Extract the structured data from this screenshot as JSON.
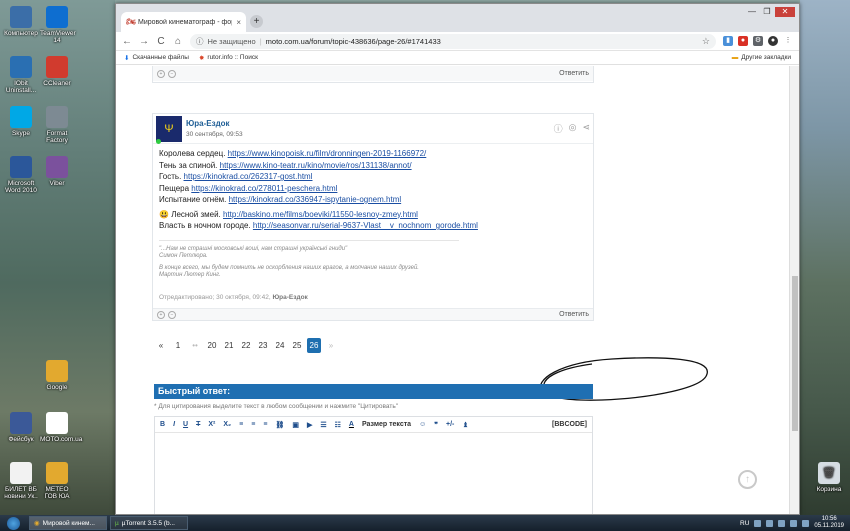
{
  "desktop": {
    "icons_left": [
      {
        "label": "Компьютер",
        "icon": "computer-icon",
        "color": "#3b6ea8"
      },
      {
        "label": "TeamViewer 14",
        "icon": "teamviewer-icon",
        "color": "#0e6ed0"
      },
      {
        "label": "IObit Uninstall...",
        "icon": "iobit-icon",
        "color": "#2a6fb2"
      },
      {
        "label": "CCleaner",
        "icon": "ccleaner-icon",
        "color": "#d13b2e"
      },
      {
        "label": "Skype",
        "icon": "skype-icon",
        "color": "#00a8e6"
      },
      {
        "label": "Format Factory",
        "icon": "formatfactory-icon",
        "color": "#7d8a93"
      },
      {
        "label": "Microsoft Word 2010",
        "icon": "word-icon",
        "color": "#2b579a"
      },
      {
        "label": "Viber",
        "icon": "viber-icon",
        "color": "#7b519d"
      },
      {
        "label": "Google",
        "icon": "chrome-icon",
        "color": "#e2a92f"
      },
      {
        "label": "Фейсбук",
        "icon": "facebook-icon",
        "color": "#3b5998"
      },
      {
        "label": "МОТО.com.ua",
        "icon": "moto-icon",
        "color": "#ffffff"
      },
      {
        "label": "БИЛЕТ ВБ новини Ук..",
        "icon": "file-icon",
        "color": "#f2f2f2"
      },
      {
        "label": "МЕТЕО ГОВ ЮА",
        "icon": "chrome-icon",
        "color": "#e2a92f"
      }
    ],
    "recycle_bin": "Корзина"
  },
  "browser": {
    "tab_title": "Мировой кинематограф - фор...",
    "tab_close": "×",
    "new_tab": "+",
    "back": "←",
    "forward": "→",
    "reload": "C",
    "home": "⌂",
    "security": "Не защищено",
    "url": "moto.com.ua/forum/topic-438636/page-26/#1741433",
    "bookmarks": [
      "Скачанные файлы",
      "rutor.info :: Поиск"
    ],
    "other_bookmarks": "Другие закладки",
    "controls": {
      "min": "—",
      "max": "❐",
      "close": "✕"
    }
  },
  "page": {
    "reply_label": "Ответить",
    "post": {
      "author": "Юра-Ездок",
      "date": "30 сентября, 09:53",
      "lines": [
        {
          "text": "Королева сердец. ",
          "link": "https://www.kinopoisk.ru/film/dronningen-2019-1166972/"
        },
        {
          "text": "Тень за спиной. ",
          "link": "https://www.kino-teatr.ru/kino/movie/ros/131138/annot/"
        },
        {
          "text": "Гость. ",
          "link": "https://kinokrad.co/262317-gost.html"
        },
        {
          "text": "Пещера ",
          "link": "https://kinokrad.co/278011-peschera.html"
        },
        {
          "text": "Испытание огнём. ",
          "link": "https://kinokrad.co/336947-ispytanie-ognem.html"
        },
        {
          "text": "Лесной змей. ",
          "link": "http://baskino.me/films/boeviki/11550-lesnoy-zmey.html"
        },
        {
          "text": "Власть в ночном городе. ",
          "link": "http://seasonvar.ru/serial-9637-Vlast__v_nochnom_gorode.html"
        }
      ],
      "signature": [
        "\"...Нам не страшні московські воші, нам страшні українські гниди\"",
        "Симон Петлюра.",
        "В конце всего, мы будем помнить не оскорбления наших врагов, а молчание наших друзей.",
        "Мартин Лютер Кинг."
      ],
      "edited_prefix": "Отредактировано; 30 октября, 09:42, ",
      "edited_by": "Юра-Ездок"
    },
    "pagination": [
      "«",
      "1",
      "••",
      "20",
      "21",
      "22",
      "23",
      "24",
      "25",
      "26",
      "»"
    ],
    "current_page": "26",
    "quick_reply_title": "Быстрый ответ:",
    "quick_reply_hint": "* Для цитирования выделите текст в любом сообщении и нажмите \"Цитировать\"",
    "toolbar": {
      "bold": "B",
      "italic": "I",
      "underline": "U",
      "strike": "T",
      "sup": "X²",
      "sub": "X₂",
      "align_left": "≡",
      "align_center": "≡",
      "align_right": "≡",
      "link": "⛓",
      "image": "▣",
      "video": "▶",
      "ul": "☰",
      "ol": "☷",
      "color": "A",
      "size": "Размер текста",
      "smile": "☺",
      "quote": "❞",
      "plusminus": "+/-",
      "spoiler": "♝",
      "bbcode": "[BBCODE]"
    },
    "to_top": "↑"
  },
  "taskbar": {
    "buttons": [
      "Мировой кинем...",
      "µTorrent 3.5.5  (b..."
    ],
    "lang": "RU",
    "time": "10:56",
    "date": "05.11.2019"
  }
}
